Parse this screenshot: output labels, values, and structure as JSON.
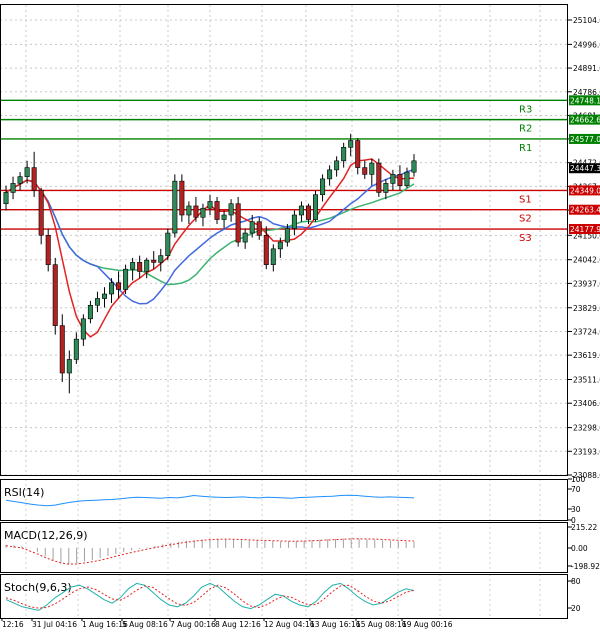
{
  "chart_data": {
    "type": "candlestick",
    "price_axis": {
      "ylim": [
        23088,
        25104
      ],
      "ticks": [
        "25104.0",
        "24996.0",
        "24891.0",
        "24786.0",
        "24681.0",
        "24577.0",
        "24472.0",
        "24367.0",
        "24262.0",
        "24150.0",
        "24042.0",
        "23937.0",
        "23829.0",
        "23724.0",
        "23619.0",
        "23511.0",
        "23406.0",
        "23298.0",
        "23193.0",
        "23088.0"
      ]
    },
    "time_axis": [
      "12:16",
      "31 Jul 04:16",
      "1 Aug 16:16",
      "5 Aug 08:16",
      "7 Aug 00:16",
      "8 Aug 12:16",
      "12 Aug 04:16",
      "13 Aug 16:16",
      "15 Aug 08:16",
      "19 Aug 00:16"
    ],
    "levels": [
      {
        "name": "R3",
        "value": 24748.1,
        "label": "24748.1",
        "color": "#008000"
      },
      {
        "name": "R2",
        "value": 24662.6,
        "label": "24662.6",
        "color": "#008000"
      },
      {
        "name": "R1",
        "value": 24577.0,
        "label": "24577.0",
        "color": "#008000"
      },
      {
        "name": "S1",
        "value": 24349.0,
        "label": "24349.0",
        "color": "#cc0000"
      },
      {
        "name": "S2",
        "value": 24263.4,
        "label": "24263.4",
        "color": "#cc0000"
      },
      {
        "name": "S3",
        "value": 24177.9,
        "label": "24177.9",
        "color": "#cc0000"
      }
    ],
    "last_price": {
      "value": 24447.3,
      "label": "24447.3"
    },
    "candles": [
      [
        24290,
        24370,
        24260,
        24340
      ],
      [
        24340,
        24410,
        24310,
        24380
      ],
      [
        24380,
        24430,
        24350,
        24410
      ],
      [
        24410,
        24480,
        24380,
        24450
      ],
      [
        24450,
        24520,
        24320,
        24350
      ],
      [
        24350,
        24360,
        24110,
        24150
      ],
      [
        24150,
        24180,
        23990,
        24020
      ],
      [
        24020,
        24050,
        23710,
        23750
      ],
      [
        23750,
        23800,
        23500,
        23540
      ],
      [
        23540,
        23640,
        23450,
        23600
      ],
      [
        23600,
        23720,
        23580,
        23690
      ],
      [
        23690,
        23800,
        23660,
        23780
      ],
      [
        23780,
        23860,
        23760,
        23840
      ],
      [
        23840,
        23900,
        23810,
        23870
      ],
      [
        23870,
        23920,
        23830,
        23890
      ],
      [
        23890,
        23960,
        23850,
        23940
      ],
      [
        23940,
        23990,
        23870,
        23910
      ],
      [
        23910,
        24020,
        23890,
        24000
      ],
      [
        24000,
        24050,
        23950,
        24030
      ],
      [
        24030,
        24060,
        23960,
        23990
      ],
      [
        23990,
        24050,
        23960,
        24040
      ],
      [
        24040,
        24080,
        24000,
        24030
      ],
      [
        24030,
        24090,
        23990,
        24060
      ],
      [
        24060,
        24180,
        24040,
        24160
      ],
      [
        24160,
        24420,
        24140,
        24390
      ],
      [
        24390,
        24420,
        24210,
        24240
      ],
      [
        24240,
        24300,
        24200,
        24280
      ],
      [
        24280,
        24320,
        24210,
        24230
      ],
      [
        24230,
        24290,
        24190,
        24270
      ],
      [
        24270,
        24330,
        24240,
        24300
      ],
      [
        24300,
        24320,
        24200,
        24220
      ],
      [
        24220,
        24260,
        24180,
        24240
      ],
      [
        24240,
        24310,
        24210,
        24290
      ],
      [
        24290,
        24320,
        24100,
        24120
      ],
      [
        24120,
        24180,
        24090,
        24160
      ],
      [
        24160,
        24240,
        24140,
        24210
      ],
      [
        24210,
        24230,
        24130,
        24150
      ],
      [
        24150,
        24190,
        24000,
        24020
      ],
      [
        24020,
        24110,
        23990,
        24090
      ],
      [
        24090,
        24140,
        24050,
        24120
      ],
      [
        24120,
        24200,
        24100,
        24180
      ],
      [
        24180,
        24260,
        24150,
        24240
      ],
      [
        24240,
        24300,
        24210,
        24280
      ],
      [
        24280,
        24290,
        24200,
        24220
      ],
      [
        24220,
        24350,
        24210,
        24330
      ],
      [
        24330,
        24420,
        24300,
        24400
      ],
      [
        24400,
        24460,
        24370,
        24440
      ],
      [
        24440,
        24500,
        24410,
        24480
      ],
      [
        24480,
        24560,
        24450,
        24540
      ],
      [
        24540,
        24600,
        24500,
        24570
      ],
      [
        24570,
        24580,
        24420,
        24450
      ],
      [
        24450,
        24480,
        24400,
        24420
      ],
      [
        24420,
        24490,
        24370,
        24470
      ],
      [
        24470,
        24490,
        24320,
        24340
      ],
      [
        24340,
        24400,
        24310,
        24380
      ],
      [
        24380,
        24440,
        24350,
        24420
      ],
      [
        24420,
        24460,
        24350,
        24370
      ],
      [
        24370,
        24450,
        24360,
        24430
      ],
      [
        24430,
        24510,
        24410,
        24480
      ]
    ],
    "indicators": [
      {
        "title": "RSI(14)",
        "ylim": [
          0,
          100
        ],
        "ticks": [
          "100",
          "70",
          "30",
          "0"
        ],
        "values": [
          48,
          44,
          40,
          36,
          33,
          31,
          33,
          38,
          42,
          45,
          47,
          48,
          49,
          50,
          52,
          55,
          57,
          56,
          55,
          54,
          56,
          55,
          58,
          62,
          60,
          58,
          57,
          56,
          57,
          58,
          56,
          55,
          57,
          56,
          55,
          54,
          56,
          57,
          58,
          59,
          60,
          62,
          63,
          62,
          60,
          58,
          57,
          58,
          57,
          56,
          55
        ]
      },
      {
        "title": "MACD(12,26,9)",
        "ylim": [
          -198.92,
          215.22
        ],
        "ticks": [
          "215.22",
          "0.00",
          "-198.92"
        ],
        "histogram": [
          30,
          25,
          15,
          0,
          -40,
          -80,
          -120,
          -150,
          -160,
          -150,
          -135,
          -120,
          -100,
          -80,
          -60,
          -40,
          -25,
          -10,
          5,
          20,
          35,
          50,
          60,
          70,
          75,
          80,
          85,
          88,
          85,
          80,
          75,
          70,
          72,
          70,
          65,
          60,
          62,
          65,
          70,
          75,
          80,
          85,
          88,
          90,
          92,
          90,
          85,
          80,
          75,
          70,
          65,
          60,
          55
        ],
        "signal": [
          20,
          10,
          0,
          -30,
          -60,
          -95,
          -125,
          -150,
          -160,
          -158,
          -150,
          -138,
          -122,
          -104,
          -84,
          -64,
          -46,
          -29,
          -13,
          2,
          17,
          31,
          44,
          56,
          66,
          74,
          80,
          84,
          86,
          85,
          82,
          78,
          75,
          73,
          70,
          67,
          65,
          65,
          66,
          69,
          73,
          77,
          81,
          85,
          88,
          89,
          88,
          86,
          82,
          78,
          74,
          70,
          66
        ]
      },
      {
        "title": "Stoch(9,6,3)",
        "ylim": [
          0,
          100
        ],
        "ticks": [
          "80",
          "20"
        ],
        "k": [
          40,
          30,
          20,
          15,
          10,
          25,
          45,
          60,
          75,
          80,
          70,
          55,
          40,
          30,
          45,
          70,
          85,
          80,
          60,
          40,
          25,
          20,
          30,
          50,
          75,
          85,
          75,
          55,
          35,
          20,
          15,
          25,
          40,
          55,
          50,
          35,
          25,
          20,
          35,
          60,
          80,
          85,
          70,
          50,
          35,
          25,
          30,
          45,
          60,
          70,
          65
        ],
        "d": [
          45,
          38,
          28,
          20,
          16,
          18,
          28,
          42,
          58,
          70,
          75,
          68,
          55,
          42,
          38,
          50,
          66,
          78,
          74,
          58,
          42,
          28,
          24,
          32,
          50,
          70,
          80,
          72,
          55,
          36,
          22,
          18,
          26,
          40,
          50,
          46,
          35,
          26,
          26,
          42,
          62,
          78,
          80,
          66,
          50,
          36,
          30,
          36,
          48,
          60,
          66
        ]
      }
    ]
  }
}
